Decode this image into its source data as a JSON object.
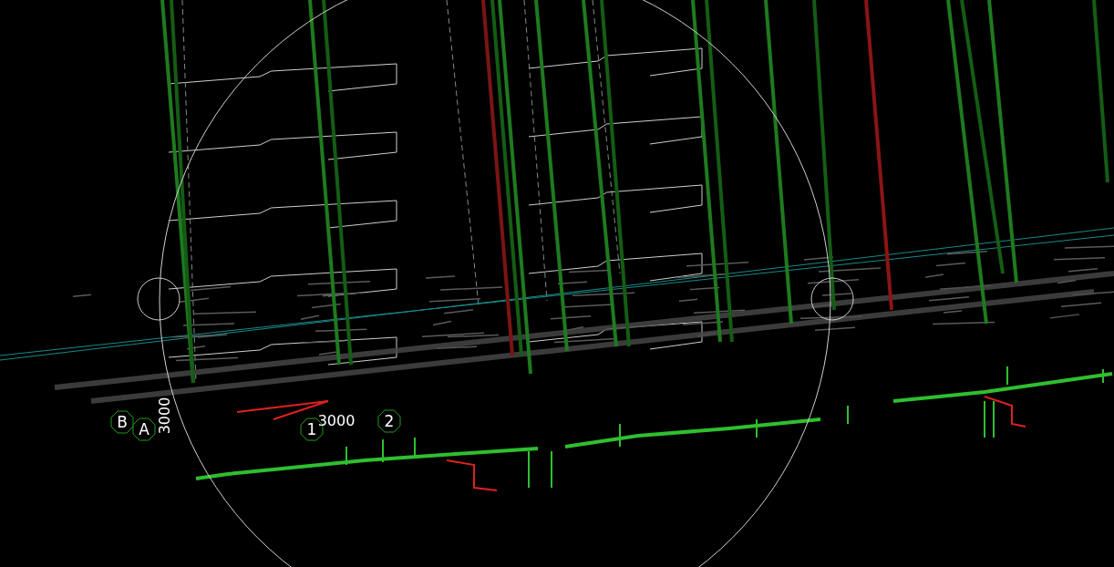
{
  "viewport": {
    "labels": [
      {
        "kind": "bubble",
        "text": "B"
      },
      {
        "kind": "bubble",
        "text": "A"
      },
      {
        "kind": "vertical_dimension",
        "text": "3000"
      },
      {
        "kind": "bubble",
        "text": "1"
      },
      {
        "kind": "dimension",
        "text": "3000"
      },
      {
        "kind": "bubble",
        "text": "2"
      }
    ]
  }
}
